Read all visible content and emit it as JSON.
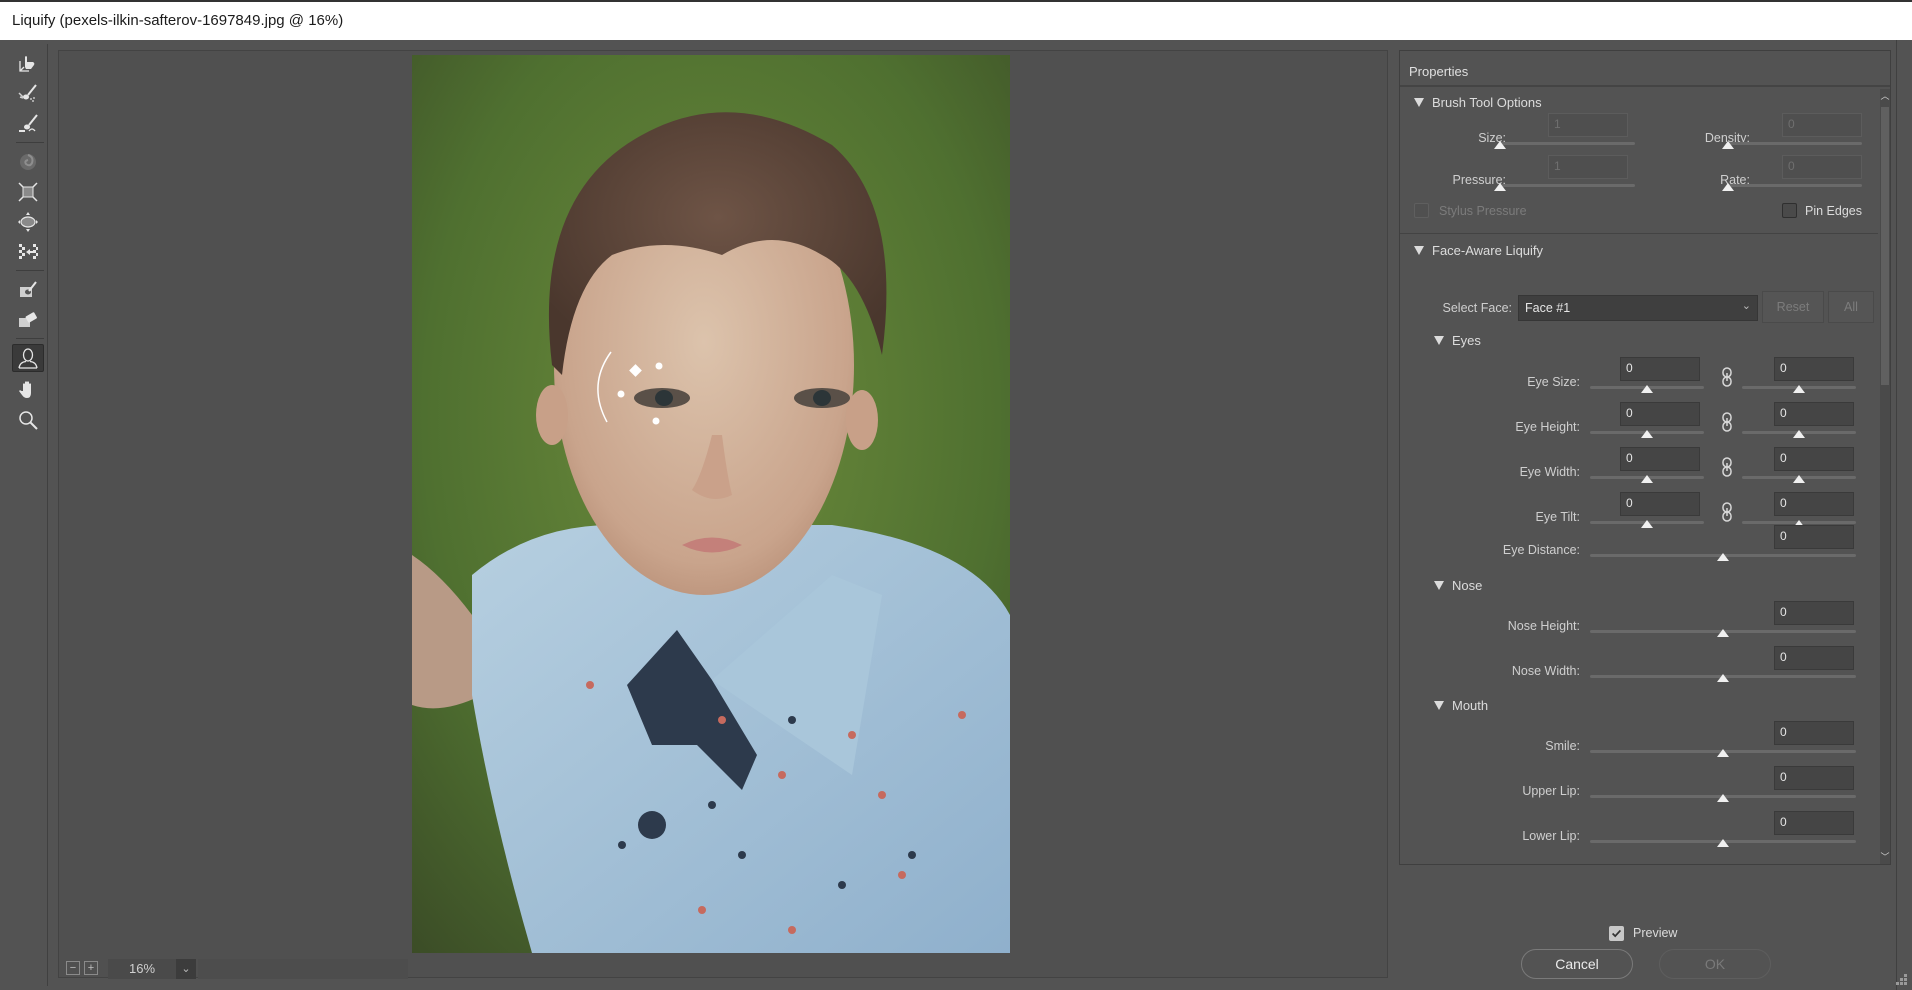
{
  "window": {
    "title": "Liquify (pexels-ilkin-safterov-1697849.jpg @ 16%)"
  },
  "toolbar": {
    "tools": [
      {
        "name": "forward-warp-tool",
        "icon": "warp-hand-icon",
        "active": false
      },
      {
        "name": "reconstruct-tool",
        "icon": "reconstruct-brush-icon",
        "active": false
      },
      {
        "name": "smooth-tool",
        "icon": "smooth-brush-icon",
        "active": false
      },
      {
        "name": "twirl-clockwise-tool",
        "icon": "twirl-icon",
        "active": false
      },
      {
        "name": "pucker-tool",
        "icon": "pucker-icon",
        "active": false
      },
      {
        "name": "bloat-tool",
        "icon": "bloat-icon",
        "active": false
      },
      {
        "name": "push-left-tool",
        "icon": "push-left-icon",
        "active": false
      },
      {
        "name": "freeze-mask-tool",
        "icon": "freeze-mask-icon",
        "active": false
      },
      {
        "name": "thaw-mask-tool",
        "icon": "thaw-mask-icon",
        "active": false
      },
      {
        "name": "face-tool",
        "icon": "face-icon",
        "active": true
      },
      {
        "name": "hand-tool",
        "icon": "hand-icon",
        "active": false
      },
      {
        "name": "zoom-tool",
        "icon": "magnifier-icon",
        "active": false
      }
    ]
  },
  "statusbar": {
    "zoom_out": "−",
    "zoom_in": "+",
    "zoom_value": "16%",
    "zoom_dropdown": "⌄"
  },
  "properties": {
    "title": "Properties",
    "brush_tool_options": {
      "heading": "Brush Tool Options",
      "size_label": "Size:",
      "size_value": "1",
      "size_level": 0,
      "density_label": "Density:",
      "density_value": "0",
      "density_level": 0,
      "pressure_label": "Pressure:",
      "pressure_value": "1",
      "pressure_level": 0,
      "rate_label": "Rate:",
      "rate_value": "0",
      "rate_level": 0,
      "stylus_pressure_label": "Stylus Pressure",
      "stylus_pressure_checked": false,
      "pin_edges_label": "Pin Edges",
      "pin_edges_checked": false
    },
    "face_aware": {
      "heading": "Face-Aware Liquify",
      "select_face_label": "Select Face:",
      "select_face_value": "Face #1",
      "reset_label": "Reset",
      "all_label": "All",
      "eyes": {
        "heading": "Eyes",
        "rows": [
          {
            "label": "Eye Size:",
            "left": "0",
            "right": "0",
            "left_level": 0.5,
            "right_level": 0.5
          },
          {
            "label": "Eye Height:",
            "left": "0",
            "right": "0",
            "left_level": 0.5,
            "right_level": 0.5
          },
          {
            "label": "Eye Width:",
            "left": "0",
            "right": "0",
            "left_level": 0.5,
            "right_level": 0.5
          },
          {
            "label": "Eye Tilt:",
            "left": "0",
            "right": "0",
            "left_level": 0.5,
            "right_level": 0.5
          }
        ],
        "distance": {
          "label": "Eye Distance:",
          "value": "0",
          "level": 0.5
        }
      },
      "nose": {
        "heading": "Nose",
        "rows": [
          {
            "label": "Nose Height:",
            "value": "0",
            "level": 0.5
          },
          {
            "label": "Nose Width:",
            "value": "0",
            "level": 0.5
          }
        ]
      },
      "mouth": {
        "heading": "Mouth",
        "rows": [
          {
            "label": "Smile:",
            "value": "0",
            "level": 0.5
          },
          {
            "label": "Upper Lip:",
            "value": "0",
            "level": 0.5
          },
          {
            "label": "Lower Lip:",
            "value": "0",
            "level": 0.5
          }
        ]
      }
    }
  },
  "footer": {
    "preview_label": "Preview",
    "preview_checked": true,
    "cancel_label": "Cancel",
    "ok_label": "OK"
  }
}
